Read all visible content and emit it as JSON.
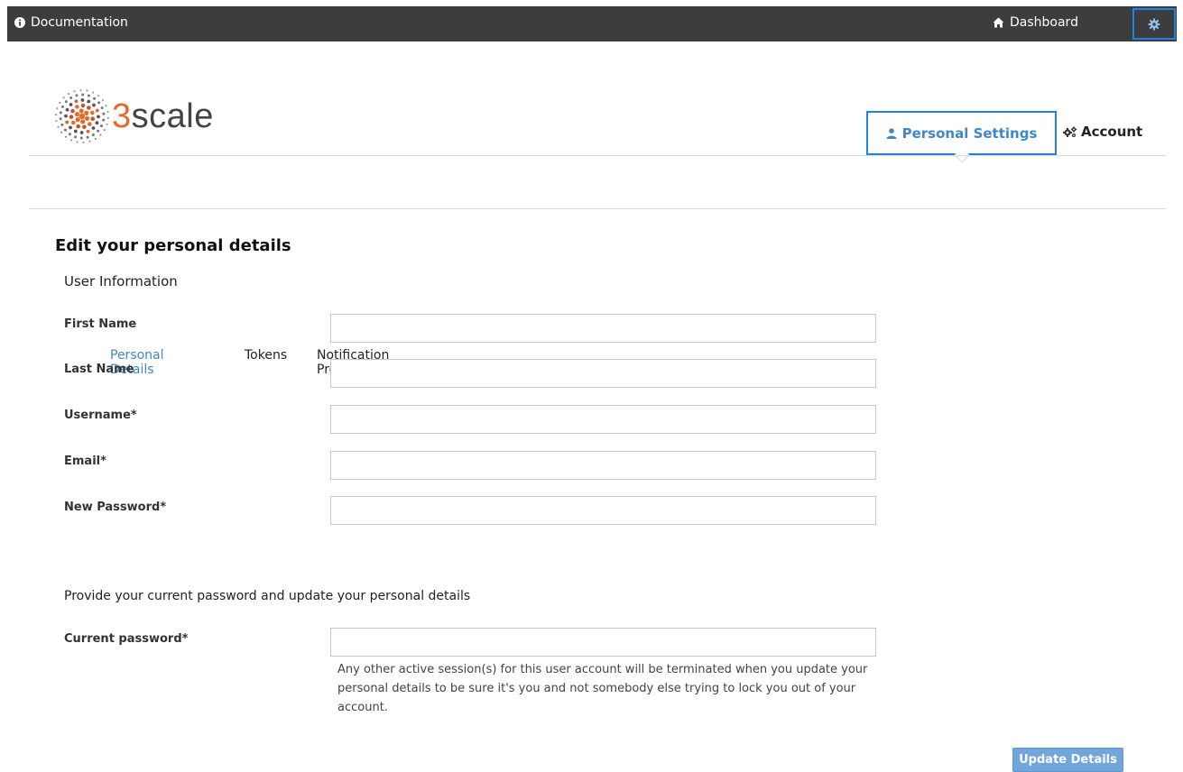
{
  "topbar": {
    "documentation_label": "Documentation",
    "dashboard_label": "Dashboard"
  },
  "logo": {
    "brand_digit": "3",
    "brand_word": "scale"
  },
  "header_tabs": {
    "personal_settings": "Personal Settings",
    "account": "Account"
  },
  "subnav": {
    "items": [
      "Personal Details",
      "Tokens",
      "Notification Preferences"
    ],
    "active": "Personal Details"
  },
  "form": {
    "title": "Edit your personal details",
    "section_user_info": "User Information",
    "fields": [
      {
        "label": "First Name",
        "value": ""
      },
      {
        "label": "Last Name",
        "value": ""
      },
      {
        "label": "Username*",
        "value": ""
      },
      {
        "label": "Email*",
        "value": ""
      },
      {
        "label": "New Password*",
        "value": ""
      }
    ],
    "section_current_password": "Provide your current password and update your personal details",
    "current_password": {
      "label": "Current password*",
      "value": ""
    },
    "hint": "Any other active session(s) for this user account will be terminated when you update your personal details to be sure it's you and not somebody else trying to lock you out of your account.",
    "submit_label": "Update Details"
  },
  "colors": {
    "topbar_bg": "#3d3d3d",
    "accent_blue": "#3f87c9",
    "highlight_border": "#1e82e6",
    "brand_orange": "#e26c2c",
    "button_bg": "#70a6db"
  }
}
